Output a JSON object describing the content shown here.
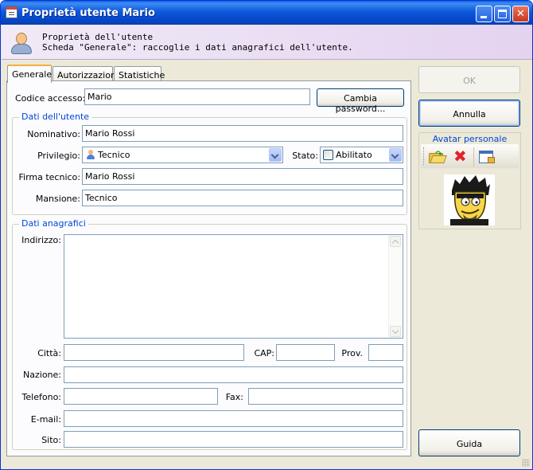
{
  "window": {
    "title": "Proprietà utente Mario",
    "controls": {
      "minimize": "minimize-icon",
      "maximize": "maximize-icon",
      "close": "close-icon"
    }
  },
  "header": {
    "title": "Proprietà dell'utente",
    "description": "Scheda \"Generale\": raccoglie i dati anagrafici dell'utente."
  },
  "tabs": [
    {
      "label": "Generale",
      "active": true
    },
    {
      "label": "Autorizzazioni",
      "active": false
    },
    {
      "label": "Statistiche",
      "active": false
    }
  ],
  "general": {
    "codice_accesso": {
      "label": "Codice accesso:",
      "value": "Mario"
    },
    "cambia_password_label": "Cambia password...",
    "dati_utente": {
      "legend": "Dati dell'utente",
      "nominativo": {
        "label": "Nominativo:",
        "value": "Mario Rossi"
      },
      "privilegio": {
        "label": "Privilegio:",
        "value": "Tecnico"
      },
      "stato": {
        "label": "Stato:",
        "value": "Abilitato"
      },
      "firma_tecnico": {
        "label": "Firma tecnico:",
        "value": "Mario Rossi"
      },
      "mansione": {
        "label": "Mansione:",
        "value": "Tecnico"
      }
    },
    "dati_anagrafici": {
      "legend": "Dati anagrafici",
      "indirizzo": {
        "label": "Indirizzo:",
        "value": ""
      },
      "citta": {
        "label": "Città:",
        "value": ""
      },
      "cap": {
        "label": "CAP:",
        "value": ""
      },
      "prov": {
        "label": "Prov.",
        "value": ""
      },
      "nazione": {
        "label": "Nazione:",
        "value": ""
      },
      "telefono": {
        "label": "Telefono:",
        "value": ""
      },
      "fax": {
        "label": "Fax:",
        "value": ""
      },
      "email": {
        "label": "E-mail:",
        "value": ""
      },
      "sito": {
        "label": "Sito:",
        "value": ""
      }
    }
  },
  "sidebar": {
    "ok_label": "OK",
    "annulla_label": "Annulla",
    "avatar_legend": "Avatar personale",
    "guida_label": "Guida"
  },
  "colors": {
    "titlebar": "#0a5fe3",
    "legend": "#0046d5",
    "header_bg": "#e4d3f0",
    "window_bg": "#ece9d8"
  }
}
